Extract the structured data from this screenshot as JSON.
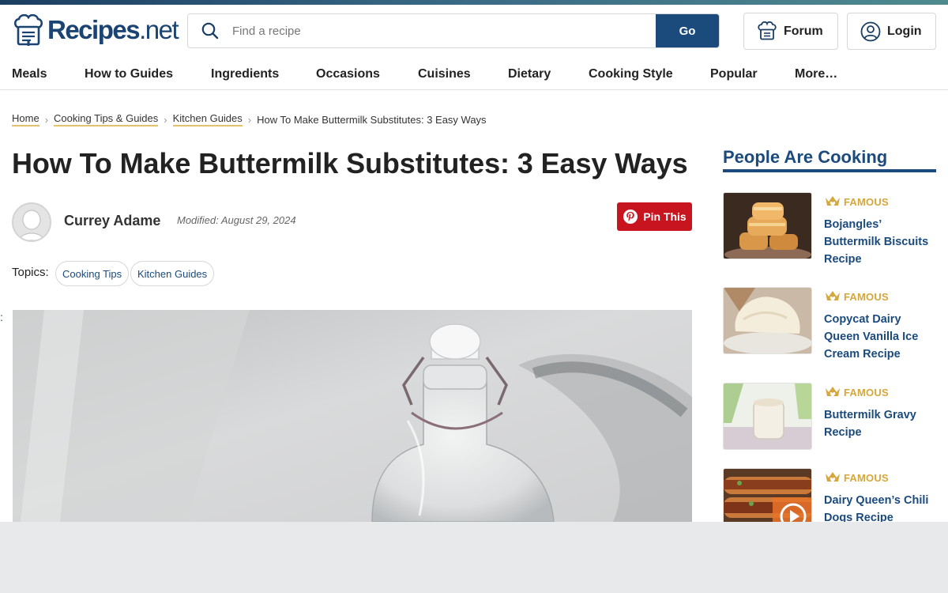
{
  "header": {
    "logo_main": "Recipes",
    "logo_suffix": "net",
    "search_placeholder": "Find a recipe",
    "go_label": "Go",
    "forum_label": "Forum",
    "login_label": "Login"
  },
  "nav": {
    "items": [
      "Meals",
      "How to Guides",
      "Ingredients",
      "Occasions",
      "Cuisines",
      "Dietary",
      "Cooking Style",
      "Popular",
      "More…"
    ]
  },
  "breadcrumb": {
    "items": [
      "Home",
      "Cooking Tips & Guides",
      "Kitchen Guides"
    ],
    "current": "How To Make Buttermilk Substitutes: 3 Easy Ways"
  },
  "article": {
    "title": "How To Make Buttermilk Substitutes: 3 Easy Ways",
    "author": "Currey Adame",
    "modified": "Modified: August 29, 2024",
    "pin_label": "Pin This",
    "topics_label": "Topics:",
    "topics": [
      "Cooking Tips",
      "Kitchen Guides"
    ],
    "edge_mark": ":"
  },
  "sidebar": {
    "title": "People Are Cooking",
    "cards": [
      {
        "badge": "FAMOUS",
        "title": "Bojangles’ Buttermilk Biscuits Recipe"
      },
      {
        "badge": "FAMOUS",
        "title": "Copycat Dairy Queen Vanilla Ice Cream Recipe"
      },
      {
        "badge": "FAMOUS",
        "title": "Buttermilk Gravy Recipe"
      },
      {
        "badge": "FAMOUS",
        "title": "Dairy Queen’s Chili Dogs Recipe"
      }
    ]
  },
  "colors": {
    "brand_blue": "#1b4a7d",
    "pinterest_red": "#c8141e",
    "badge_gold": "#d6a73c"
  }
}
